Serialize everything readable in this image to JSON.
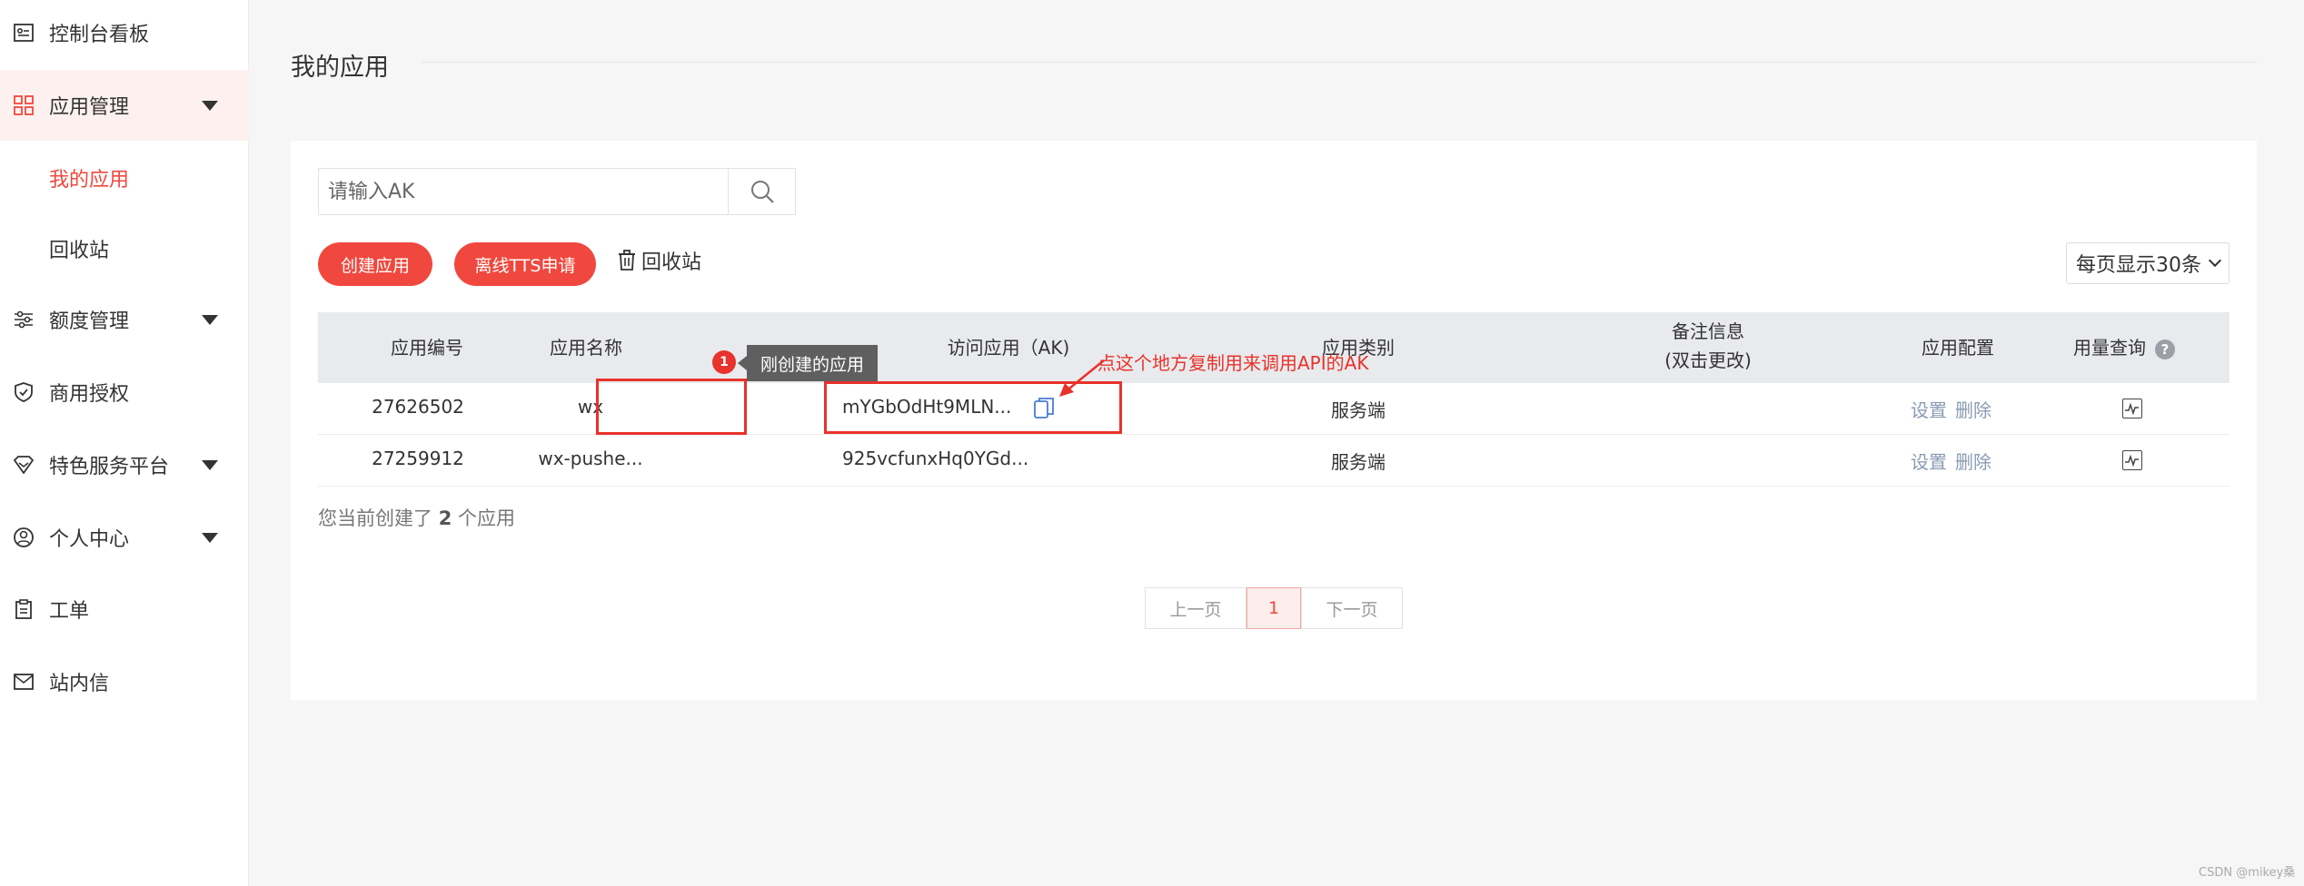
{
  "sidebar": {
    "items": [
      {
        "label": "控制台看板",
        "icon": "dashboard-icon"
      },
      {
        "label": "应用管理",
        "icon": "grid-icon",
        "expanded": true
      },
      {
        "label": "额度管理",
        "icon": "sliders-icon"
      },
      {
        "label": "商用授权",
        "icon": "shield-icon"
      },
      {
        "label": "特色服务平台",
        "icon": "tag-icon"
      },
      {
        "label": "个人中心",
        "icon": "user-icon"
      },
      {
        "label": "工单",
        "icon": "clipboard-icon"
      },
      {
        "label": "站内信",
        "icon": "mail-icon"
      }
    ],
    "sub": {
      "my_apps": "我的应用",
      "recycle": "回收站"
    }
  },
  "main": {
    "title": "我的应用",
    "search": {
      "placeholder": "请输入AK",
      "value": ""
    },
    "buttons": {
      "create": "创建应用",
      "offline_tts": "离线TTS申请",
      "recycle": "回收站"
    },
    "page_size": "每页显示30条",
    "table": {
      "headers": [
        "应用编号",
        "应用名称",
        "访问应用（AK)",
        "应用类别",
        "备注信息",
        "(双击更改)",
        "应用配置",
        "用量查询"
      ],
      "rows": [
        {
          "id": "27626502",
          "name": "wx",
          "ak": "mYGbOdHt9MLN...",
          "type": "服务端",
          "remark": "",
          "settings": "设置",
          "delete": "删除"
        },
        {
          "id": "27259912",
          "name": "wx-pushe...",
          "ak": "925vcfunxHq0YGd...",
          "type": "服务端",
          "remark": "",
          "settings": "设置",
          "delete": "删除"
        }
      ]
    },
    "count": {
      "prefix": "您当前创建了",
      "num": "2",
      "suffix": "个应用"
    },
    "pager": {
      "prev": "上一页",
      "current": "1",
      "next": "下一页"
    }
  },
  "annotations": {
    "badge": "1",
    "tooltip": "刚创建的应用",
    "note": "点这个地方复制用来调用API的AK"
  },
  "watermark": "CSDN @mikey桑",
  "colors": {
    "accent": "#f0483e",
    "annotation": "#e8322b",
    "header_bg": "#e9eaed"
  }
}
